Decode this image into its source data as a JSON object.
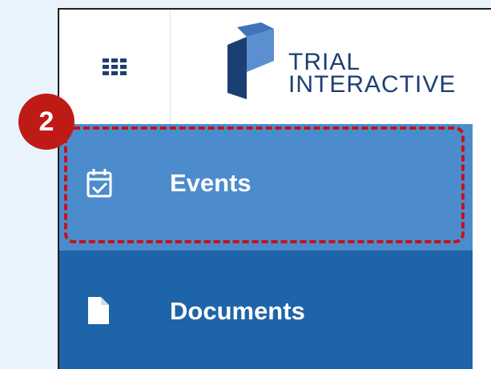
{
  "logo": {
    "line1": "TRIAL",
    "line2": "INTERACTIVE"
  },
  "nav": {
    "items": [
      {
        "label": "Events",
        "icon": "calendar-check-icon",
        "active": true
      },
      {
        "label": "Documents",
        "icon": "document-icon",
        "active": false
      }
    ]
  },
  "annotation": {
    "step": "2",
    "color": "#c4131b"
  },
  "colors": {
    "sidebar": "#1e64a8",
    "active_item": "#4c8ccc",
    "brand": "#1c3f73"
  }
}
